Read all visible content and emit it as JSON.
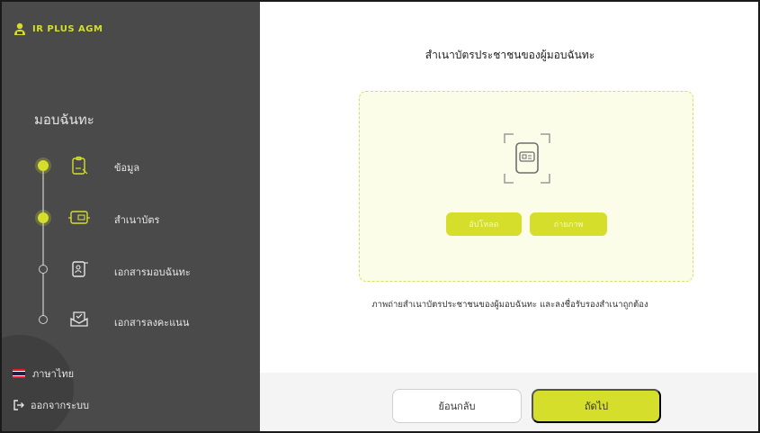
{
  "brand": {
    "name": "IR PLUS AGM",
    "accent": "#d4de2b",
    "logo_icon": "user-shield-icon"
  },
  "sidebar": {
    "section_title": "มอบฉันทะ",
    "steps": [
      {
        "label": "ข้อมูล",
        "icon": "clipboard-icon",
        "status": "done"
      },
      {
        "label": "สำเนาบัตร",
        "icon": "id-card-icon",
        "status": "done"
      },
      {
        "label": "เอกสารมอบฉันทะ",
        "icon": "proxy-document-icon",
        "status": "todo"
      },
      {
        "label": "เอกสารลงคะแนน",
        "icon": "ballot-icon",
        "status": "todo"
      }
    ],
    "language": {
      "label": "ภาษาไทย",
      "icon": "thai-flag-icon"
    },
    "logout": {
      "label": "ออกจากระบบ",
      "icon": "logout-icon"
    }
  },
  "main": {
    "title": "สำเนาบัตรประชาชนของผู้มอบฉันทะ",
    "upload_area_icon": "id-card-scan-icon",
    "upload_button": "อัปโหลด",
    "camera_button": "ถ่ายภาพ",
    "hint": "ภาพถ่ายสำเนาบัตรประชาชนของผู้มอบฉันทะ และลงชื่อรับรองสำเนาถูกต้อง"
  },
  "footer": {
    "back_label": "ย้อนกลับ",
    "next_label": "ถัดไป"
  }
}
